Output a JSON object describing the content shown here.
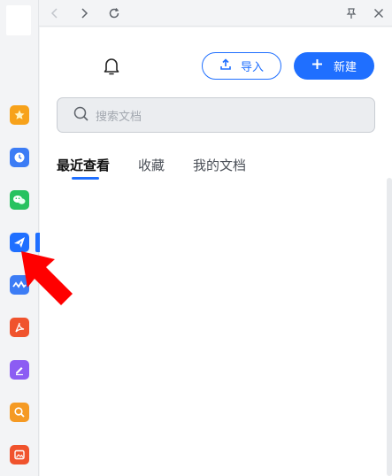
{
  "toolbar": {
    "back_icon": "chevron-left-icon",
    "forward_icon": "chevron-right-icon",
    "refresh_icon": "refresh-icon",
    "pin_icon": "pin-icon",
    "close_icon": "close-icon"
  },
  "rail": {
    "items": [
      {
        "name": "starred",
        "icon": "star-icon",
        "color": "#f7a21b"
      },
      {
        "name": "recent",
        "icon": "clock-icon",
        "color": "#3c7cf5"
      },
      {
        "name": "wechat",
        "icon": "wechat-icon",
        "color": "#27c25f"
      },
      {
        "name": "transfer",
        "icon": "send-icon",
        "color": "#1f6fff"
      },
      {
        "name": "chart",
        "icon": "wave-icon",
        "color": "#3c7cf5"
      },
      {
        "name": "pdf",
        "icon": "pdf-icon",
        "color": "#f0532d"
      },
      {
        "name": "edit",
        "icon": "pen-icon",
        "color": "#8c5cf3"
      },
      {
        "name": "search",
        "icon": "magnifier-icon",
        "color": "#f59a24"
      },
      {
        "name": "image",
        "icon": "image-icon",
        "color": "#f0532d"
      }
    ]
  },
  "header": {
    "import_label": "导入",
    "new_label": "新建"
  },
  "search": {
    "placeholder": "搜索文档"
  },
  "tabs": [
    {
      "label": "最近查看",
      "active": true
    },
    {
      "label": "收藏",
      "active": false
    },
    {
      "label": "我的文档",
      "active": false
    }
  ],
  "colors": {
    "accent": "#1f6fff",
    "annotation_arrow": "#ff0000"
  }
}
